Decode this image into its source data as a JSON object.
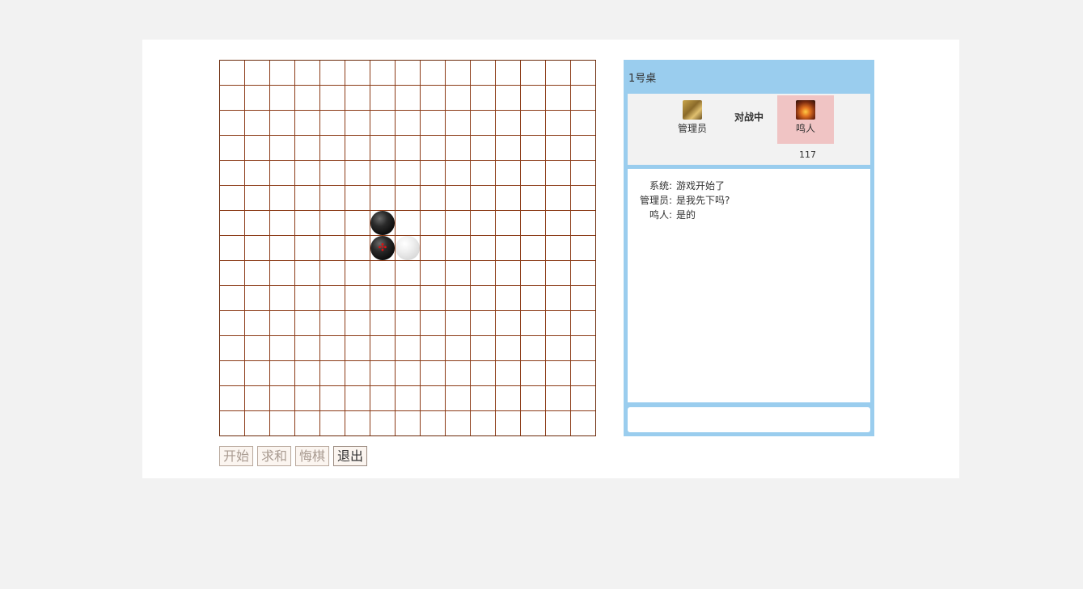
{
  "board": {
    "size": 15,
    "stones": [
      {
        "color": "black",
        "col": 6,
        "row": 6,
        "last": false
      },
      {
        "color": "black",
        "col": 6,
        "row": 7,
        "last": true
      },
      {
        "color": "white",
        "col": 7,
        "row": 7,
        "last": false
      }
    ],
    "last_move_mark": "✣"
  },
  "buttons": {
    "start": "开始",
    "draw": "求和",
    "undo": "悔棋",
    "exit": "退出"
  },
  "room": {
    "title": "1号桌",
    "status": "对战中",
    "players": [
      {
        "name": "管理员",
        "avatar": "autumn-avatar-icon"
      },
      {
        "name": "鸣人",
        "avatar": "fire-avatar-icon",
        "score": "117"
      }
    ]
  },
  "chat": {
    "messages": [
      {
        "sender": "系统:",
        "text": "游戏开始了"
      },
      {
        "sender": "管理员:",
        "text": "是我先下吗?"
      },
      {
        "sender": "鸣人:",
        "text": "是的"
      }
    ],
    "input_value": ""
  },
  "colors": {
    "panel_accent": "#9acdee",
    "opponent_highlight": "#f0c4c4",
    "grid_line": "#8b3a16"
  }
}
